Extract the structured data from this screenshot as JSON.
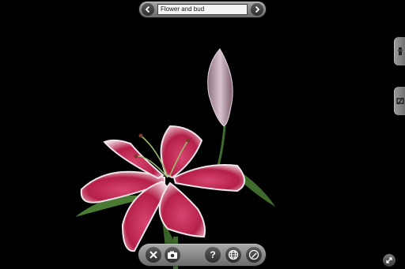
{
  "scene": {
    "title": "Flower and bud",
    "subject": "lily"
  },
  "icons": {
    "prev": "chevron-left-icon",
    "next": "chevron-right-icon",
    "close": "close-icon",
    "camera": "camera-icon",
    "help": "help-icon",
    "globe": "globe-icon",
    "draw": "pencil-icon",
    "tab_one": "info-tab-icon",
    "tab_two": "edit-tab-icon",
    "resize": "resize-icon"
  },
  "colors": {
    "background": "#000000",
    "petal": "#c8305a",
    "petal_edge": "#f3e4ea",
    "bud": "#b6a0ae",
    "stem": "#3f6b2c"
  }
}
